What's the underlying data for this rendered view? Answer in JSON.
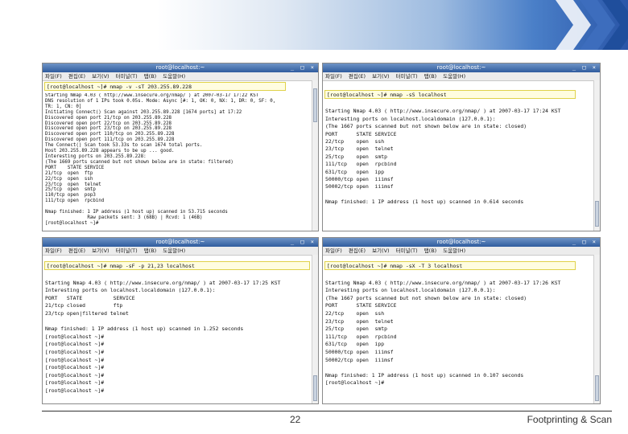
{
  "slide": {
    "page_number": "22",
    "footer_title": "Footprinting & Scan"
  },
  "windows": [
    {
      "title": "root@localhost:~",
      "controls": "_ □ ×",
      "menu": [
        "파일(F)",
        "편집(E)",
        "보기(V)",
        "터미널(T)",
        "탭(B)",
        "도움말(H)"
      ],
      "command": "[root@localhost ~]# nmap -v -sT 203.255.89.228",
      "lines": [
        "Starting Nmap 4.03 ( http://www.insecure.org/nmap/ ) at 2007-03-17 17:22 KST",
        "DNS resolution of 1 IPs took 0.05s. Mode: Async [#: 1, OK: 0, NX: 1, DR: 0, SF: 0,",
        "TR: 1, CN: 0]",
        "Initiating Connect() Scan against 203.255.89.228 [1674 ports] at 17:22",
        "Discovered open port 21/tcp on 203.255.89.228",
        "Discovered open port 22/tcp on 203.255.89.228",
        "Discovered open port 23/tcp on 203.255.89.228",
        "Discovered open port 110/tcp on 203.255.89.228",
        "Discovered open port 111/tcp on 203.255.89.228",
        "The Connect() Scan took 53.33s to scan 1674 total ports.",
        "Host 203.255.89.228 appears to be up ... good.",
        "Interesting ports on 203.255.89.228:",
        "(The 1669 ports scanned but not shown below are in state: filtered)",
        "PORT    STATE SERVICE",
        "21/tcp  open  ftp",
        "22/tcp  open  ssh",
        "23/tcp  open  telnet",
        "25/tcp  open  smtp",
        "110/tcp open  pop3",
        "111/tcp open  rpcbind",
        "",
        "Nmap finished: 1 IP address (1 host up) scanned in 53.715 seconds",
        "               Raw packets sent: 3 (68B) | Rcvd: 1 (46B)",
        "[root@localhost ~]#"
      ]
    },
    {
      "title": "root@localhost:~",
      "controls": "_ □ ×",
      "menu": [
        "파일(F)",
        "편집(E)",
        "보기(V)",
        "터미널(T)",
        "탭(B)",
        "도움말(H)"
      ],
      "command": "[root@localhost ~]# nmap -sS localhost",
      "lines": [
        "",
        "Starting Nmap 4.03 ( http://www.insecure.org/nmap/ ) at 2007-03-17 17:24 KST",
        "Interesting ports on localhost.localdomain (127.0.0.1):",
        "(The 1667 ports scanned but not shown below are in state: closed)",
        "PORT      STATE SERVICE",
        "22/tcp    open  ssh",
        "23/tcp    open  telnet",
        "25/tcp    open  smtp",
        "111/tcp   open  rpcbind",
        "631/tcp   open  ipp",
        "50000/tcp open  iiimsf",
        "50002/tcp open  iiimsf",
        "",
        "Nmap finished: 1 IP address (1 host up) scanned in 0.614 seconds"
      ]
    },
    {
      "title": "root@localhost:~",
      "controls": "_ □ ×",
      "menu": [
        "파일(F)",
        "편집(E)",
        "보기(V)",
        "터미널(T)",
        "탭(B)",
        "도움말(H)"
      ],
      "command": "[root@localhost ~]# nmap -sF -p 21,23 localhost",
      "lines": [
        "",
        "Starting Nmap 4.03 ( http://www.insecure.org/nmap/ ) at 2007-03-17 17:25 KST",
        "Interesting ports on localhost.localdomain (127.0.0.1):",
        "PORT   STATE          SERVICE",
        "21/tcp closed         ftp",
        "23/tcp open|filtered telnet",
        "",
        "Nmap finished: 1 IP address (1 host up) scanned in 1.252 seconds",
        "[root@localhost ~]#",
        "[root@localhost ~]#",
        "[root@localhost ~]#",
        "[root@localhost ~]#",
        "[root@localhost ~]#",
        "[root@localhost ~]#",
        "[root@localhost ~]#",
        "[root@localhost ~]#"
      ]
    },
    {
      "title": "root@localhost:~",
      "controls": "_ □ ×",
      "menu": [
        "파일(F)",
        "편집(E)",
        "보기(V)",
        "터미널(T)",
        "탭(B)",
        "도움말(H)"
      ],
      "command": "[root@localhost ~]# nmap -sX -T 3 localhost",
      "lines": [
        "",
        "Starting Nmap 4.03 ( http://www.insecure.org/nmap/ ) at 2007-03-17 17:26 KST",
        "Interesting ports on localhost.localdomain (127.0.0.1):",
        "(The 1667 ports scanned but not shown below are in state: closed)",
        "PORT      STATE SERVICE",
        "22/tcp    open  ssh",
        "23/tcp    open  telnet",
        "25/tcp    open  smtp",
        "111/tcp   open  rpcbind",
        "631/tcp   open  ipp",
        "50000/tcp open  iiimsf",
        "50002/tcp open  iiimsf",
        "",
        "Nmap finished: 1 IP address (1 host up) scanned in 0.107 seconds",
        "[root@localhost ~]#"
      ]
    }
  ]
}
